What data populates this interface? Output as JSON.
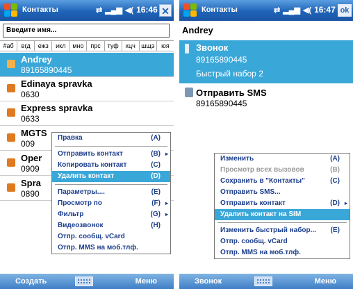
{
  "left": {
    "title": "Контакты",
    "time": "16:46",
    "close_label": "✕",
    "search_placeholder": "Введите имя...",
    "alphabet": [
      "#аб",
      "вгд",
      "ежз",
      "икл",
      "мно",
      "прс",
      "туф",
      "хцч",
      "шщэ",
      "юя"
    ],
    "contacts": [
      {
        "name": "Andrey",
        "phone": "89165890445"
      },
      {
        "name": "Edinaya spravka",
        "phone": "0630"
      },
      {
        "name": "Express spravka",
        "phone": "0633"
      },
      {
        "name": "MGTS",
        "phone": "009"
      },
      {
        "name": "Oper",
        "phone": "0909"
      },
      {
        "name": "Spra",
        "phone": "0890"
      }
    ],
    "menu": [
      {
        "label": "Правка",
        "shortcut": "(A)",
        "arrow": ""
      },
      {
        "sep": true
      },
      {
        "label": "Отправить контакт",
        "shortcut": "(B)",
        "arrow": "▸"
      },
      {
        "label": "Копировать контакт",
        "shortcut": "(C)",
        "arrow": ""
      },
      {
        "label": "Удалить контакт",
        "shortcut": "(D)",
        "arrow": "",
        "selected": true
      },
      {
        "sep": true
      },
      {
        "label": "Параметры....",
        "shortcut": "(E)",
        "arrow": ""
      },
      {
        "label": "Просмотр по",
        "shortcut": "(F)",
        "arrow": "▸"
      },
      {
        "label": "Фильтр",
        "shortcut": "(G)",
        "arrow": "▸"
      },
      {
        "label": "Видеозвонок",
        "shortcut": "(H)",
        "arrow": ""
      },
      {
        "label": "Отпр. сообщ. vCard",
        "shortcut": "",
        "arrow": ""
      },
      {
        "label": "Отпр. MMS на моб.тлф.",
        "shortcut": "",
        "arrow": ""
      }
    ],
    "softkey_left": "Создать",
    "softkey_right": "Меню"
  },
  "right": {
    "title": "Контакты",
    "time": "16:47",
    "ok_label": "ok",
    "contact_name": "Andrey",
    "call_label": "Звонок",
    "call_number": "89165890445",
    "speed_dial": "Быстрый набор 2",
    "sms_label": "Отправить SMS",
    "sms_number": "89165890445",
    "menu": [
      {
        "label": "Изменить",
        "shortcut": "(A)",
        "arrow": ""
      },
      {
        "label": "Просмотр всех вызовов",
        "shortcut": "(B)",
        "arrow": "",
        "disabled": true
      },
      {
        "label": "Сохранить в \"Контакты\"",
        "shortcut": "(C)",
        "arrow": ""
      },
      {
        "label": "Отправить SMS...",
        "shortcut": "",
        "arrow": ""
      },
      {
        "label": "Отправить контакт",
        "shortcut": "(D)",
        "arrow": "▸"
      },
      {
        "label": "Удалить контакт на SIM",
        "shortcut": "",
        "arrow": "",
        "selected": true
      },
      {
        "sep": true
      },
      {
        "label": "Изменить быстрый набор...",
        "shortcut": "(E)",
        "arrow": ""
      },
      {
        "label": "Отпр. сообщ. vCard",
        "shortcut": "",
        "arrow": ""
      },
      {
        "label": "Отпр. MMS на моб.тлф.",
        "shortcut": "",
        "arrow": ""
      }
    ],
    "softkey_left": "Звонок",
    "softkey_right": "Меню"
  },
  "colors": {
    "titlebar": "#1f63b8",
    "selection": "#3aa7d9",
    "menu_text": "#1c3e8c"
  }
}
